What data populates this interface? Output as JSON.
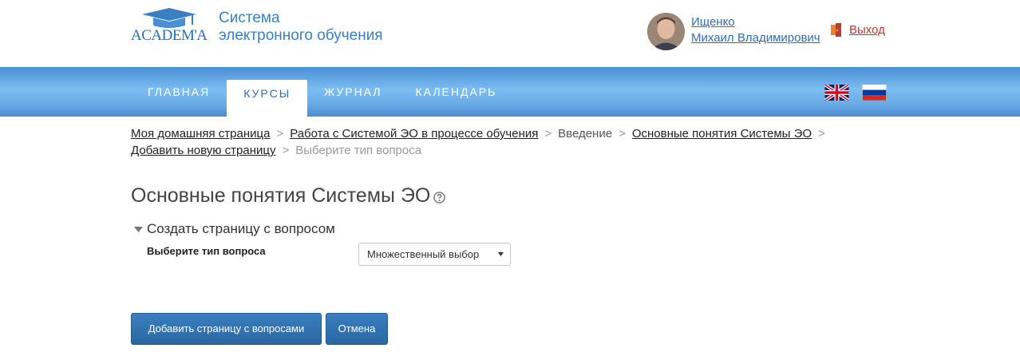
{
  "header": {
    "logo_text": "ACADEM'A",
    "site_title_line1": "Система",
    "site_title_line2": "электронного обучения",
    "user_last_name": "Ищенко",
    "user_first_names": "Михаил Владимирович",
    "logout_label": "Выход"
  },
  "nav": {
    "items": [
      {
        "label": "ГЛАВНАЯ",
        "active": false
      },
      {
        "label": "КУРСЫ",
        "active": true
      },
      {
        "label": "ЖУРНАЛ",
        "active": false
      },
      {
        "label": "КАЛЕНДАРЬ",
        "active": false
      }
    ],
    "flags": [
      "uk-flag-icon",
      "russia-flag-icon"
    ]
  },
  "breadcrumb": {
    "items": [
      "Моя домашняя страница",
      "Работа с Системой ЭО в процессе обучения",
      "Введение",
      "Основные понятия Системы ЭО",
      "Добавить новую страницу",
      "Выберите тип вопроса"
    ],
    "separator": ">"
  },
  "main": {
    "heading": "Основные понятия Системы ЭО",
    "section_title": "Создать страницу с вопросом",
    "field_label": "Выберите тип вопроса",
    "select_value": "Множественный выбор",
    "primary_button": "Добавить страницу с вопросами",
    "cancel_button": "Отмена"
  },
  "colors": {
    "accent": "#2f6fb3",
    "logout": "#c0392b",
    "nav_gradient_mid": "#7cbdf2",
    "button": "#2a679f"
  }
}
